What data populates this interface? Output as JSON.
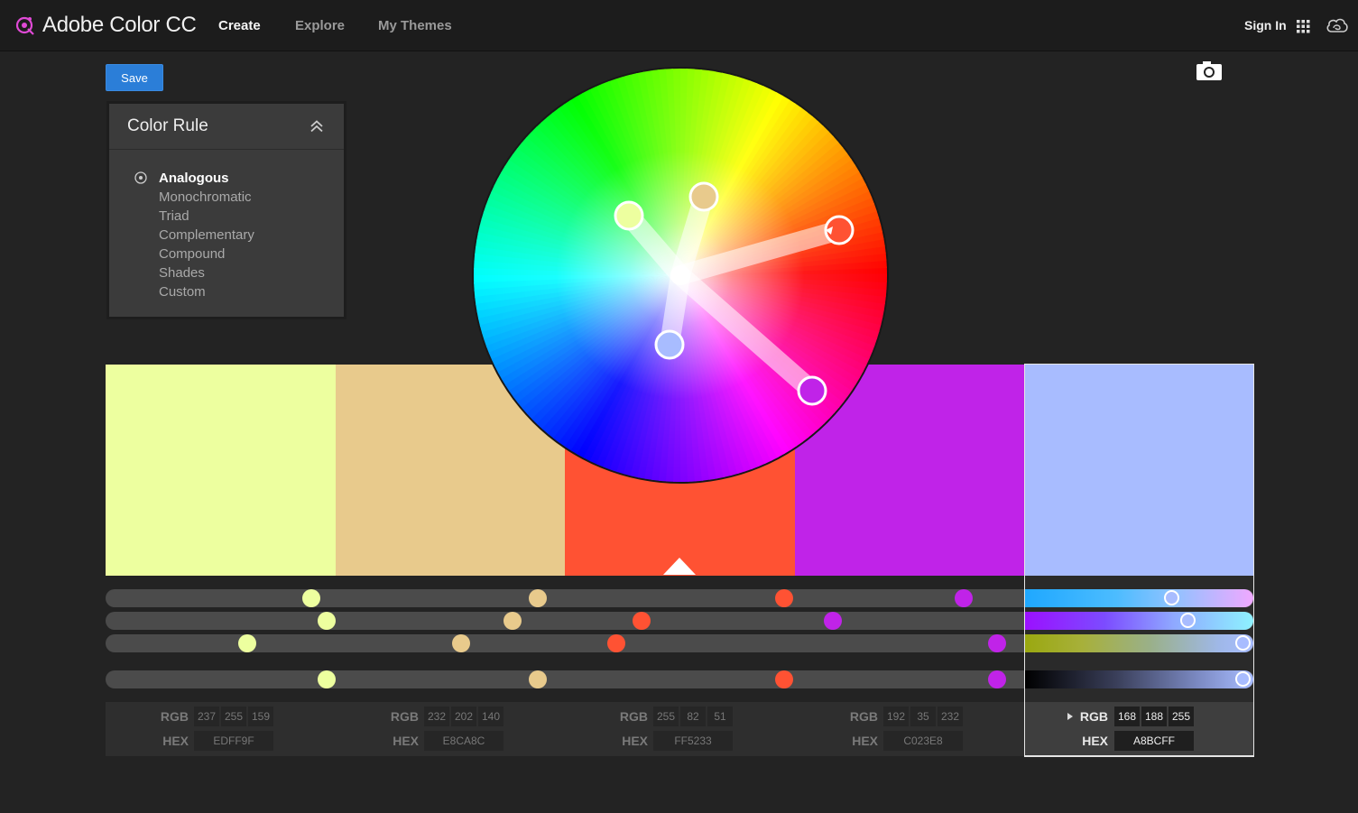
{
  "app": {
    "title": "Adobe Color CC"
  },
  "nav": {
    "create": "Create",
    "explore": "Explore",
    "my_themes": "My Themes",
    "sign_in": "Sign In"
  },
  "toolbar": {
    "save_label": "Save"
  },
  "color_rule": {
    "title": "Color Rule",
    "selected": "Analogous",
    "items": [
      "Analogous",
      "Monochromatic",
      "Triad",
      "Complementary",
      "Compound",
      "Shades",
      "Custom"
    ]
  },
  "swatches": [
    {
      "hex": "EDFF9F",
      "rgb": [
        "237",
        "255",
        "159"
      ],
      "color": "#EDFF9F"
    },
    {
      "hex": "E8CA8C",
      "rgb": [
        "232",
        "202",
        "140"
      ],
      "color": "#E8CA8C"
    },
    {
      "hex": "FF5233",
      "rgb": [
        "255",
        "82",
        "51"
      ],
      "color": "#FF5233"
    },
    {
      "hex": "C023E8",
      "rgb": [
        "192",
        "35",
        "232"
      ],
      "color": "#C023E8"
    },
    {
      "hex": "A8BCFF",
      "rgb": [
        "168",
        "188",
        "255"
      ],
      "color": "#A8BCFF"
    }
  ],
  "labels": {
    "rgb": "RGB",
    "hex": "HEX"
  },
  "active_swatch_index": 4,
  "colors": {
    "accent": "#2b7ed8",
    "background": "#232323",
    "topbar": "#1c1c1c"
  }
}
